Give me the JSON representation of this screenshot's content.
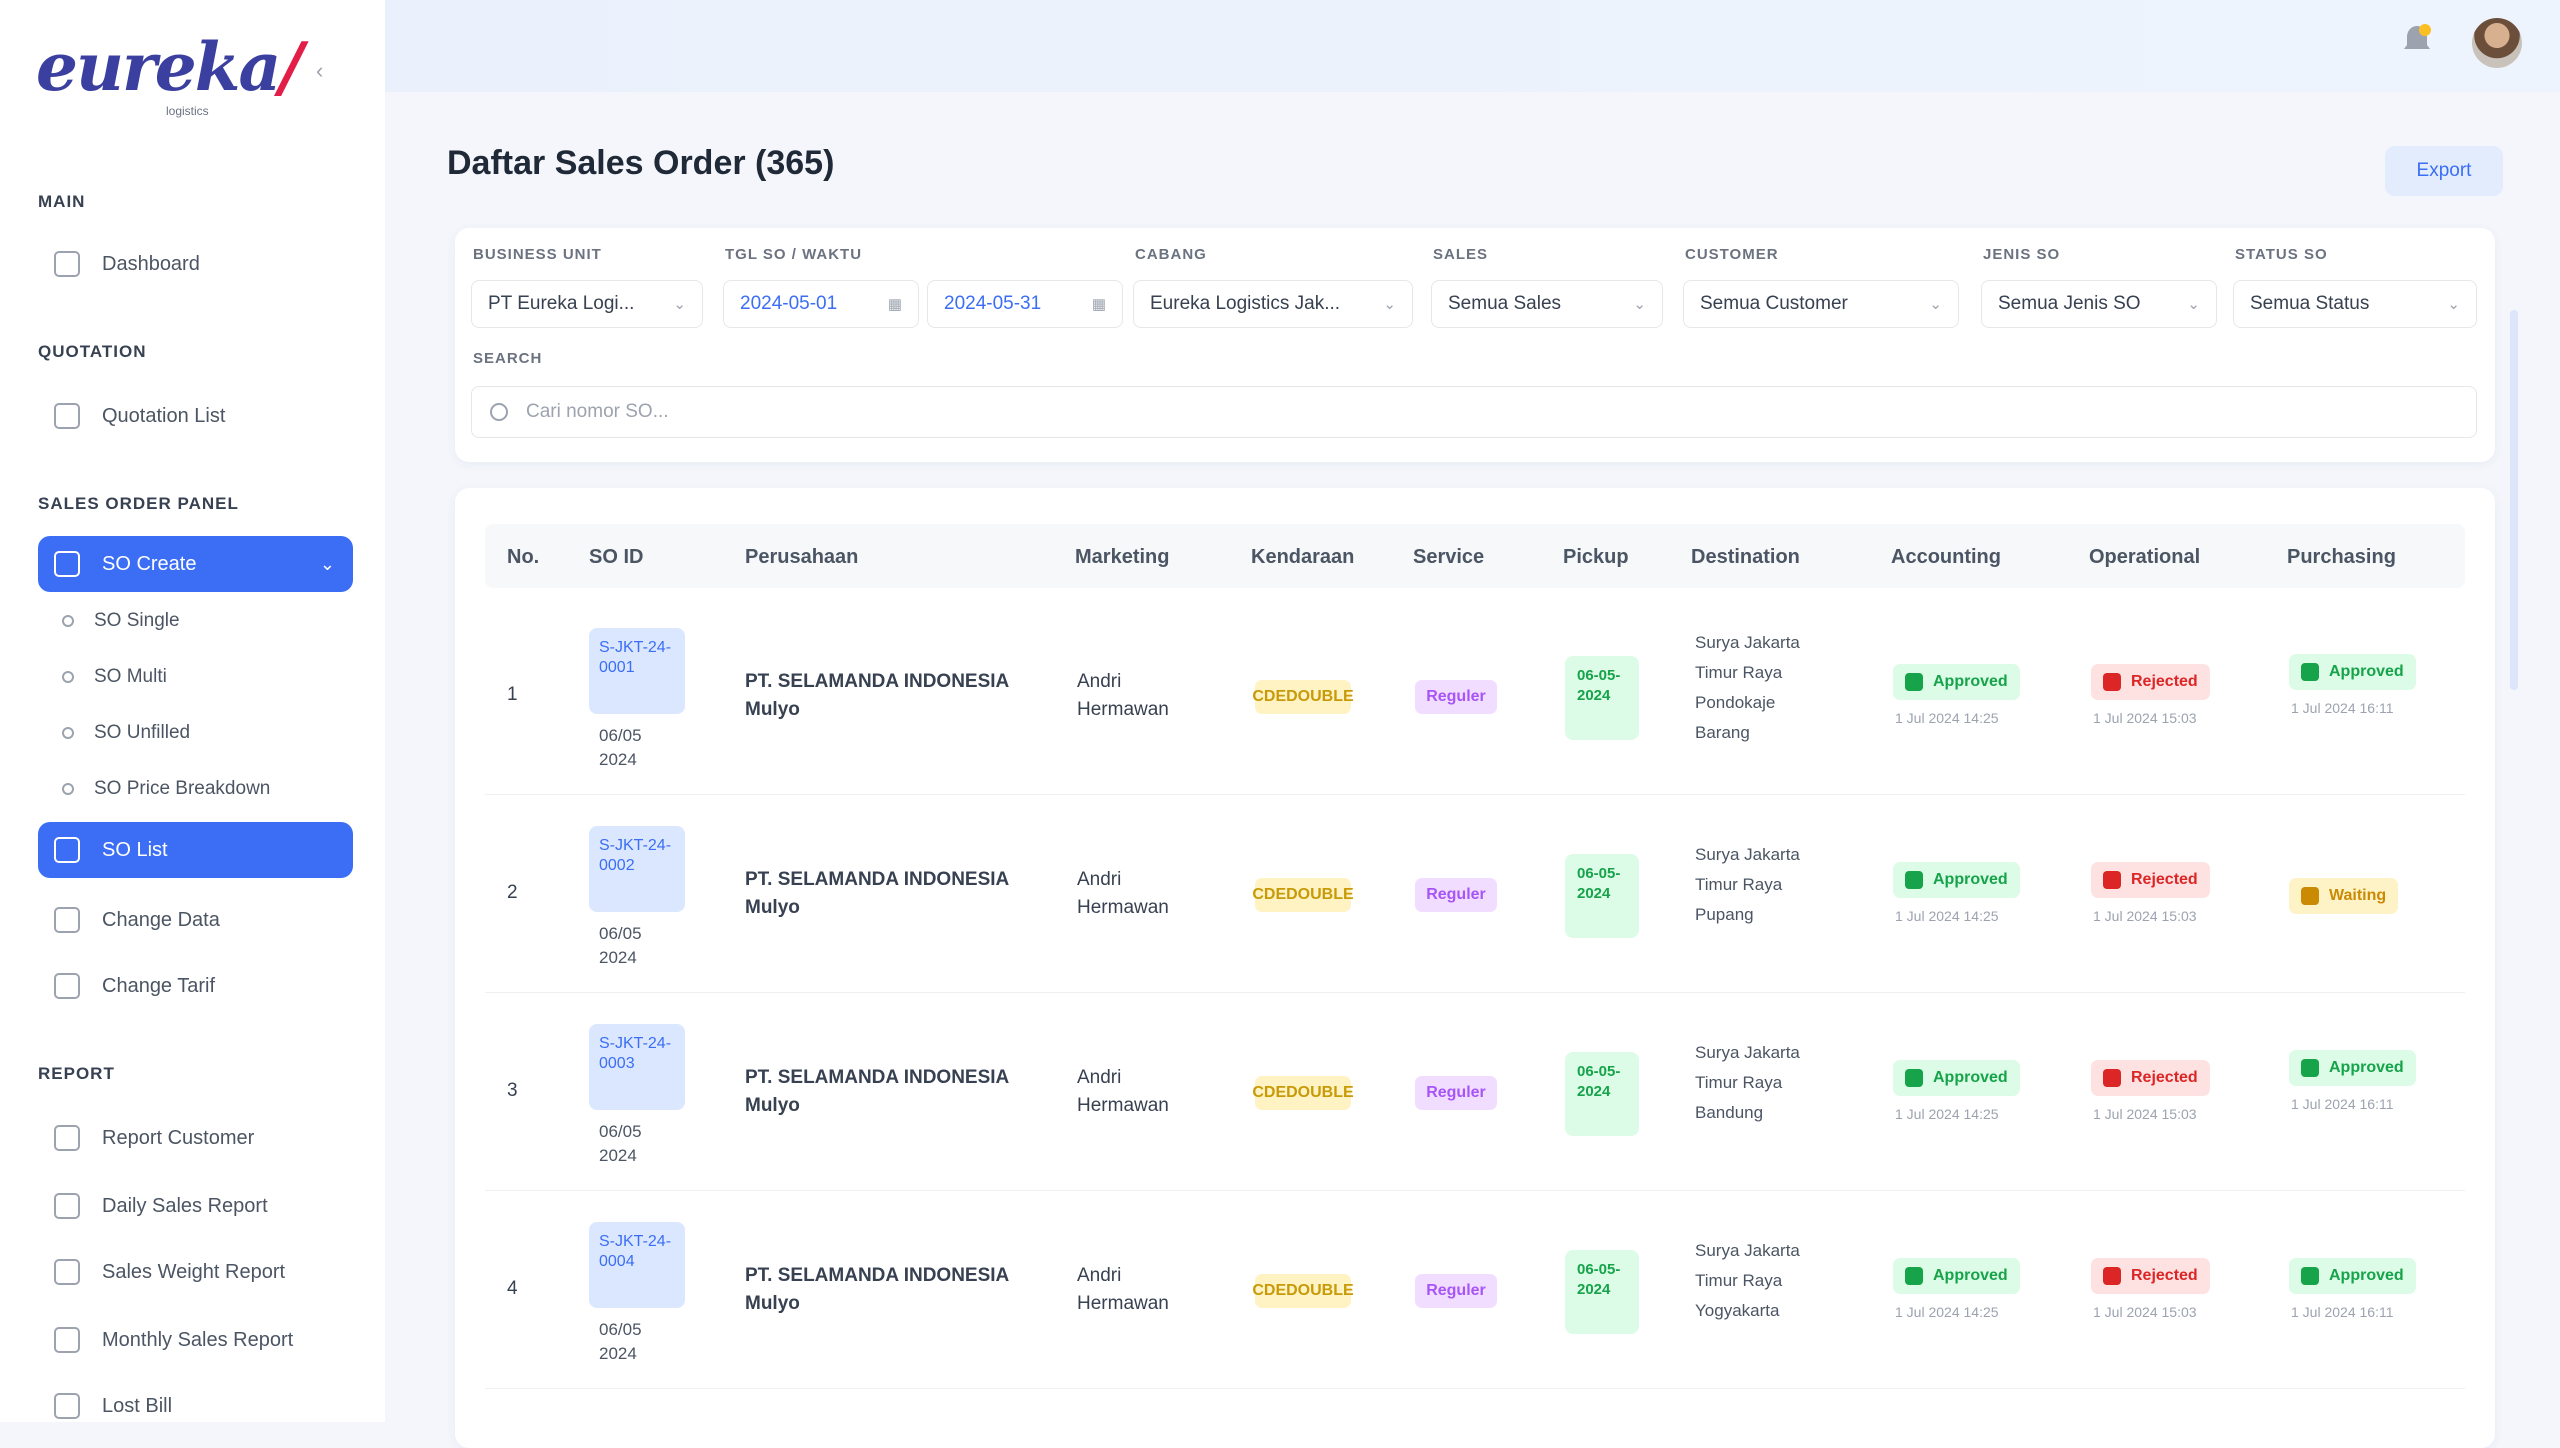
{
  "brand": {
    "logo_text": "eureka",
    "logo_slash": "/",
    "logo_sub": "logistics"
  },
  "sidebar": {
    "sections": [
      {
        "title": "MAIN",
        "items": [
          "Dashboard"
        ]
      },
      {
        "title": "QUOTATION",
        "items": [
          "Quotation List"
        ]
      },
      {
        "title": "SALES ORDER PANEL",
        "items": [
          "SO Create",
          "SO List",
          "Change Data",
          "Change Tarif"
        ],
        "sub_items": [
          "SO Single",
          "SO Multi",
          "SO Unfilled",
          "SO Price Breakdown"
        ]
      },
      {
        "title": "REPORT",
        "items": [
          "Report Customer",
          "Daily Sales Report",
          "Sales Weight Report",
          "Monthly Sales Report",
          "Lost Bill"
        ]
      }
    ]
  },
  "page": {
    "title": "Daftar Sales Order (365)",
    "export_label": "Export"
  },
  "filters": {
    "business_unit": {
      "label": "BUSINESS UNIT",
      "value": "PT Eureka Logi..."
    },
    "order_date": {
      "label": "TGL SO / WAKTU",
      "from": "2024-05-01",
      "to": "2024-05-31"
    },
    "cabang": {
      "label": "CABANG",
      "value": "Eureka Logistics Jak..."
    },
    "sales": {
      "label": "SALES",
      "value": "Semua Sales"
    },
    "customer": {
      "label": "CUSTOMER",
      "value": "Semua Customer"
    },
    "jenis_so": {
      "label": "JENIS SO",
      "value": "Semua Jenis SO"
    },
    "status": {
      "label": "STATUS SO",
      "value": "Semua Status"
    },
    "search": {
      "label": "SEARCH",
      "placeholder": "Cari nomor SO..."
    }
  },
  "table": {
    "headers": [
      "No.",
      "SO ID",
      "Perusahaan",
      "Marketing",
      "Kendaraan",
      "Service",
      "Pickup",
      "Destination",
      "Accounting",
      "Operational",
      "Purchasing"
    ],
    "rows": [
      {
        "no": "1",
        "so_id": "S-JKT-24-0001",
        "so_date": "06/05 2024",
        "company": "PT. SELAMANDA INDONESIA Mulyo",
        "marketing": "Andri Hermawan",
        "vehicle": "CDEDOUBLE",
        "service": "Reguler",
        "pickup": "06-05-2024",
        "destination": [
          "Surya Jakarta",
          "Timur Raya",
          "Pondokaje",
          "Barang"
        ],
        "accounting": "Approved",
        "accounting_note": "1 Jul 2024 14:25",
        "operational": "Rejected",
        "operational_note": "1 Jul 2024 15:03",
        "purchasing": "Approved",
        "purchasing_note": "1 Jul 2024 16:11"
      },
      {
        "no": "2",
        "so_id": "S-JKT-24-0002",
        "so_date": "06/05 2024",
        "company": "PT. SELAMANDA INDONESIA Mulyo",
        "marketing": "Andri Hermawan",
        "vehicle": "CDEDOUBLE",
        "service": "Reguler",
        "pickup": "06-05-2024",
        "destination": [
          "Surya Jakarta",
          "Timur Raya",
          "Pupang"
        ],
        "accounting": "Approved",
        "accounting_note": "1 Jul 2024 14:25",
        "operational": "Rejected",
        "operational_note": "1 Jul 2024 15:03",
        "purchasing": "Waiting",
        "purchasing_note": ""
      },
      {
        "no": "3",
        "so_id": "S-JKT-24-0003",
        "so_date": "06/05 2024",
        "company": "PT. SELAMANDA INDONESIA Mulyo",
        "marketing": "Andri Hermawan",
        "vehicle": "CDEDOUBLE",
        "service": "Reguler",
        "pickup": "06-05-2024",
        "destination": [
          "Surya Jakarta",
          "Timur Raya",
          "Bandung"
        ],
        "accounting": "Approved",
        "accounting_note": "1 Jul 2024 14:25",
        "operational": "Rejected",
        "operational_note": "1 Jul 2024 15:03",
        "purchasing": "Approved",
        "purchasing_note": "1 Jul 2024 16:11"
      },
      {
        "no": "4",
        "so_id": "S-JKT-24-0004",
        "so_date": "06/05 2024",
        "company": "PT. SELAMANDA INDONESIA Mulyo",
        "marketing": "Andri Hermawan",
        "vehicle": "CDEDOUBLE",
        "service": "Reguler",
        "pickup": "06-05-2024",
        "destination": [
          "Surya Jakarta",
          "Timur Raya",
          "Yogyakarta"
        ],
        "accounting": "Approved",
        "accounting_note": "1 Jul 2024 14:25",
        "operational": "Rejected",
        "operational_note": "1 Jul 2024 15:03",
        "purchasing": "Approved",
        "purchasing_note": "1 Jul 2024 16:11"
      }
    ]
  },
  "colors": {
    "accent": "#3b6ef5",
    "approved": "#16a34a",
    "rejected": "#dc2626",
    "waiting": "#ca8a04"
  }
}
